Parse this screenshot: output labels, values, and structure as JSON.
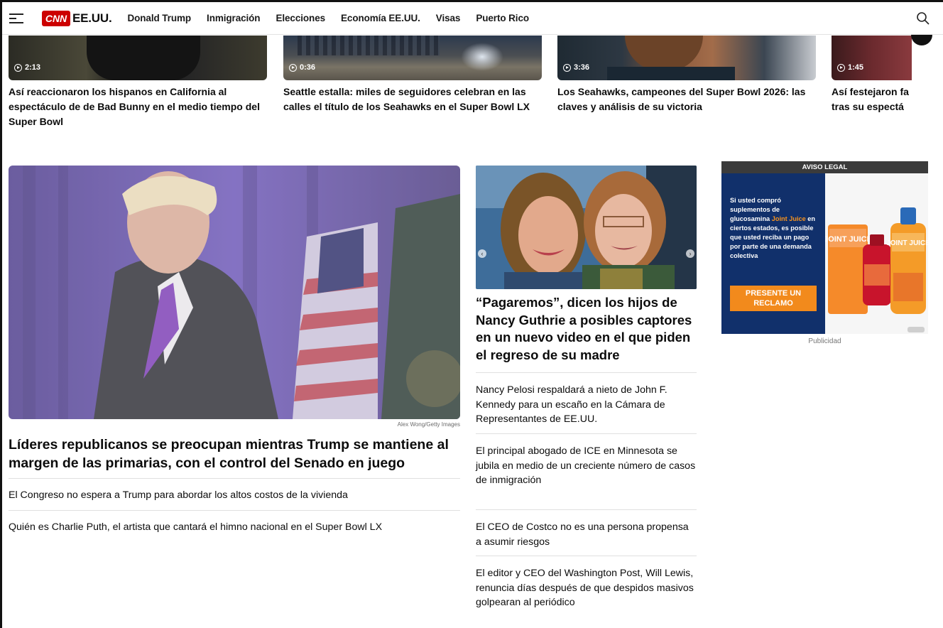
{
  "header": {
    "section_title": "EE.UU.",
    "nav": [
      "Donald Trump",
      "Inmigración",
      "Elecciones",
      "Economía EE.UU.",
      "Visas",
      "Puerto Rico"
    ],
    "brand_color": "#cc0000"
  },
  "videos": [
    {
      "duration": "2:13",
      "title": "Así reaccionaron los hispanos en California al espectáculo de de Bad Bunny en el medio tiempo del Super Bowl"
    },
    {
      "duration": "0:36",
      "title": "Seattle estalla: miles de seguidores celebran en las calles el título de los Seahawks en el Super Bowl LX"
    },
    {
      "duration": "3:36",
      "title": "Los Seahawks, campeones del Super Bowl 2026: las claves y análisis de su victoria"
    },
    {
      "duration": "1:45",
      "title": "Así festejaron fa tras su espectá"
    }
  ],
  "lead": {
    "credit": "Alex Wong/Getty Images",
    "title": "Líderes republicanos se preocupan mientras Trump se mantiene al margen de las primarias, con el control del Senado en juego",
    "links": [
      "El Congreso no espera a Trump para abordar los altos costos de la vivienda",
      "Quién es Charlie Puth, el artista que cantará el himno nacional en el Super Bowl LX"
    ]
  },
  "middle": {
    "title": "“Pagaremos”, dicen los hijos de Nancy Guthrie a posibles captores en un nuevo video en el que piden el regreso de su madre",
    "links": [
      "Nancy Pelosi respaldará a nieto de John F. Kennedy para un escaño en la Cámara de Representantes de EE.UU.",
      "El principal abogado de ICE en Minnesota se jubila en medio de un creciente número de casos de inmigración",
      "El CEO de Costco no es una persona propensa a asumir riesgos",
      "El editor y CEO del Washington Post, Will Lewis, renuncia días después de que despidos masivos golpearan al periódico"
    ]
  },
  "ad": {
    "header": "AVISO LEGAL",
    "text_1": "Si usted compró suplementos de glucosamina",
    "text_highlight": "Joint Juice",
    "text_2": "en ciertos estados, es posible que usted reciba un pago por parte de una demanda colectiva",
    "button": "PRESENTE UN RECLAMO",
    "label": "Publicidad",
    "product_name": "JOINT JUICE"
  }
}
